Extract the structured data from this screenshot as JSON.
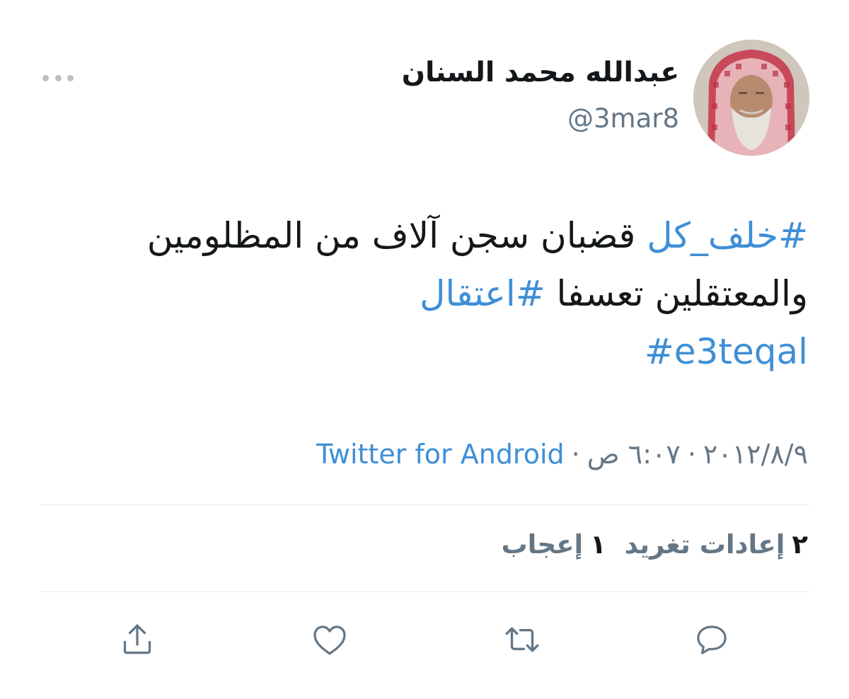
{
  "user": {
    "display_name": "عبدالله محمد السنان",
    "handle": "@3mar8"
  },
  "tweet": {
    "hashtag_1": "#خلف_كل",
    "text_1": " قضبان سجن آلاف من المظلومين والمعتقلين تعسفا ",
    "hashtag_2": "#اعتقال",
    "hashtag_3": "#e3teqal"
  },
  "meta": {
    "date": "٢٠١٢/٨/٩",
    "separator": "·",
    "time": "٦:٠٧ ص",
    "source": "Twitter for Android"
  },
  "stats": {
    "retweets_count": "٢",
    "retweets_label": "إعادات تغريد",
    "likes_count": "١",
    "likes_label": "إعجاب"
  },
  "actions": {
    "reply_icon": "speech-bubble",
    "retweet_icon": "two-arrows-loop",
    "like_icon": "heart",
    "share_icon": "upload-arrow"
  },
  "colors": {
    "link": "#3f8fd6",
    "secondary_text": "#657786",
    "primary_text": "#14171a",
    "divider": "#e1e8ed"
  }
}
